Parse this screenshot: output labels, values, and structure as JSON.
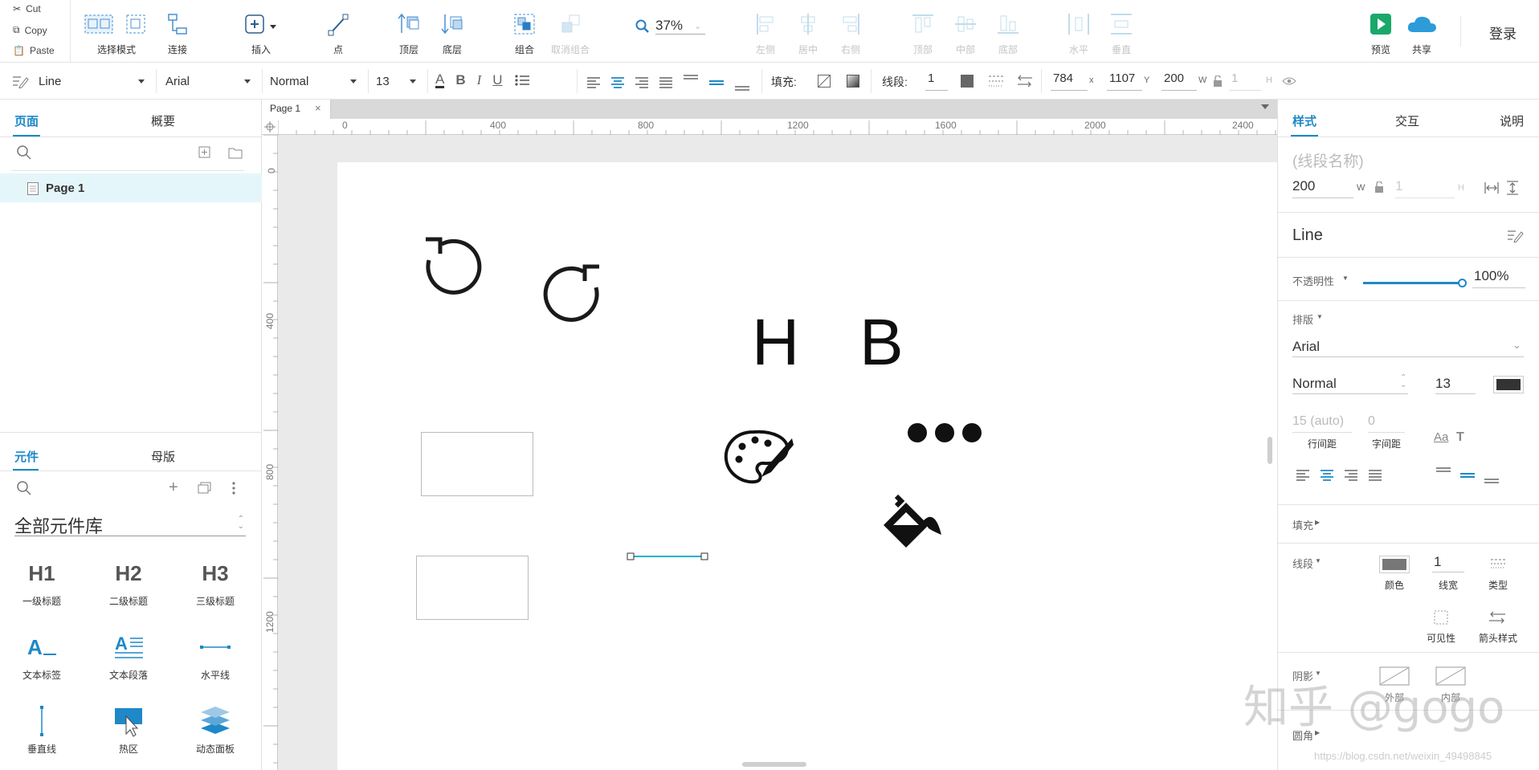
{
  "clipboard": {
    "cut": "Cut",
    "copy": "Copy",
    "paste": "Paste"
  },
  "toolbar": {
    "select_mode": "选择模式",
    "connect": "连接",
    "insert": "插入",
    "point": "点",
    "top_layer": "顶层",
    "bottom_layer": "底层",
    "group": "组合",
    "ungroup": "取消组合",
    "zoom": "37%",
    "align_left": "左侧",
    "align_center": "居中",
    "align_right": "右侧",
    "align_top": "顶部",
    "align_middle": "中部",
    "align_bottom": "底部",
    "distribute_h": "水平",
    "distribute_v": "垂直",
    "preview": "预览",
    "share": "共享",
    "login": "登录"
  },
  "formatbar": {
    "widget_type": "Line",
    "font_family": "Arial",
    "font_weight": "Normal",
    "font_size": "13",
    "fill_label": "填充:",
    "stroke_label": "线段:",
    "stroke_width": "1",
    "x": "784",
    "x_unit": "x",
    "y": "1107",
    "y_unit": "Y",
    "w": "200",
    "w_unit": "W",
    "h": "1",
    "h_unit": "H"
  },
  "left_panel": {
    "tabs": [
      "页面",
      "概要"
    ],
    "pages": [
      {
        "label": "Page 1"
      }
    ],
    "lib_tabs": [
      "元件",
      "母版"
    ],
    "library_name": "全部元件库",
    "widgets": [
      {
        "glyph": "H1",
        "label": "一级标题"
      },
      {
        "glyph": "H2",
        "label": "二级标题"
      },
      {
        "glyph": "H3",
        "label": "三级标题"
      },
      {
        "label": "文本标签"
      },
      {
        "label": "文本段落"
      },
      {
        "label": "水平线"
      },
      {
        "label": "垂直线"
      },
      {
        "label": "热区"
      },
      {
        "label": "动态面板"
      }
    ]
  },
  "canvas": {
    "tab": "Page 1",
    "ruler_h": [
      "0",
      "400",
      "800",
      "1200",
      "1600",
      "2000",
      "2400"
    ],
    "ruler_v": [
      "0",
      "400",
      "800",
      "1200"
    ],
    "letters": [
      "H",
      "B"
    ]
  },
  "right_panel": {
    "tabs": [
      "样式",
      "交互",
      "说明"
    ],
    "name_placeholder": "(线段名称)",
    "w": "200",
    "w_unit": "W",
    "h": "1",
    "h_unit": "H",
    "widget_type": "Line",
    "opacity_label": "不透明性",
    "opacity_value": "100%",
    "opacity": 1.0,
    "typography_label": "排版",
    "font_family": "Arial",
    "font_weight": "Normal",
    "font_size": "13",
    "line_spacing": "15 (auto)",
    "line_spacing_label": "行间距",
    "char_spacing": "0",
    "char_spacing_label": "字间距",
    "fill_label": "填充",
    "stroke_label": "线段",
    "stroke_color_label": "颜色",
    "stroke_width": "1",
    "stroke_width_label": "线宽",
    "stroke_type_label": "类型",
    "visibility_label": "可见性",
    "arrow_label": "箭头样式",
    "shadow_label": "阴影",
    "shadow_outer": "外部",
    "shadow_inner": "内部",
    "radius_label": "圆角"
  },
  "colors": {
    "accent": "#1e88c8",
    "selected_line": "#19b3c9",
    "page_highlight": "#e5f6fa"
  },
  "watermark": {
    "brand": "知乎 @gogo",
    "url": "https://blog.csdn.net/weixin_49498845"
  }
}
